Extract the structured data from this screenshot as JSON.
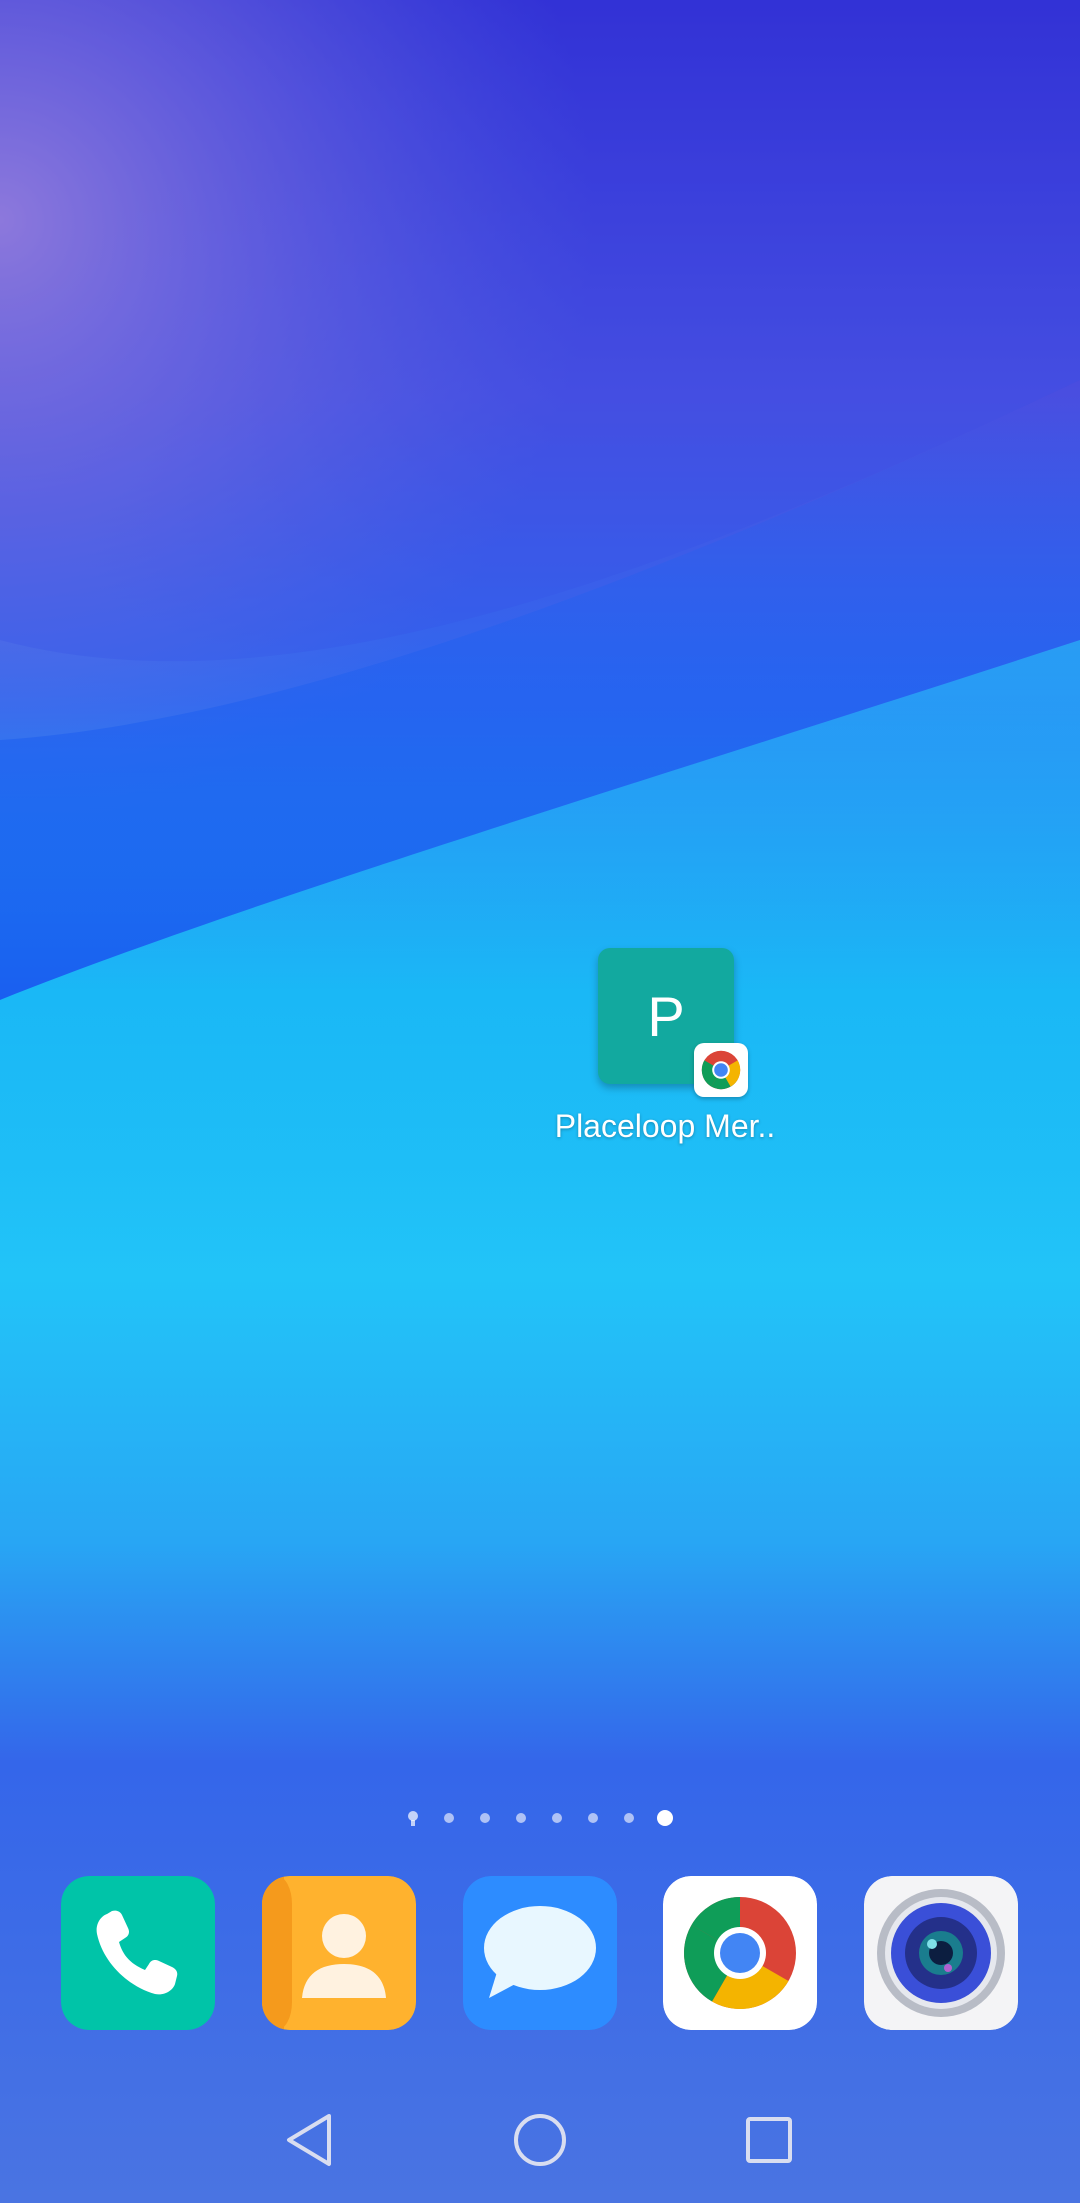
{
  "home_screen": {
    "shortcut": {
      "letter": "P",
      "label": "Placeloop Mer..",
      "tile_color": "#12a99f",
      "badge_icon": "chrome-icon"
    },
    "page_indicator": {
      "total_pages": 8,
      "current_page": 8,
      "first_page_icon": "lightbulb-icon"
    }
  },
  "dock": {
    "apps": [
      {
        "name": "Phone",
        "icon": "phone-icon",
        "color": "#00c4a8"
      },
      {
        "name": "Contacts",
        "icon": "contacts-icon",
        "color": "#ffb22e"
      },
      {
        "name": "Messages",
        "icon": "messages-icon",
        "color": "#2d8cff"
      },
      {
        "name": "Chrome",
        "icon": "chrome-icon",
        "color": "#ffffff"
      },
      {
        "name": "Camera",
        "icon": "camera-icon",
        "color": "#f4f4f6"
      }
    ]
  },
  "navigation_bar": {
    "buttons": [
      "back-icon",
      "home-icon",
      "recents-icon"
    ]
  }
}
